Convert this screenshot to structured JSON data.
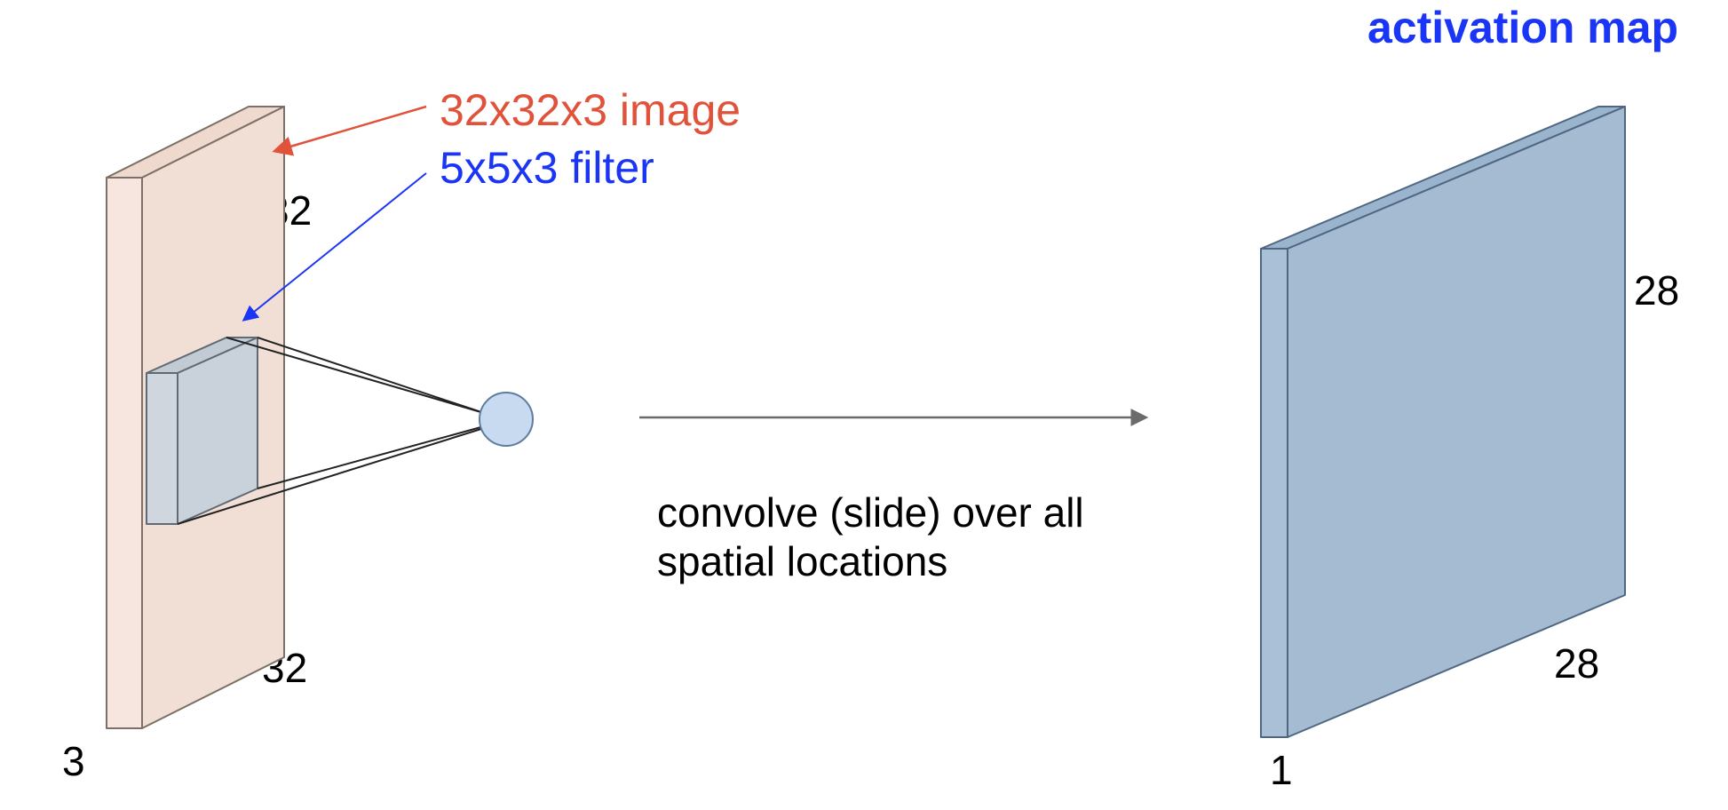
{
  "title": "activation map",
  "input": {
    "label": "32x32x3 image",
    "height": "32",
    "width": "32",
    "depth": "3"
  },
  "filter": {
    "label": "5x5x3 filter"
  },
  "operation": {
    "line1": "convolve (slide) over all",
    "line2": "spatial locations"
  },
  "output": {
    "height": "28",
    "width": "28",
    "depth": "1"
  },
  "colors": {
    "red": "#e1523b",
    "blue": "#1a35f5",
    "imageFill": "#f6e6df",
    "imageStroke": "#7d7066",
    "filterFill": "#cfd6de",
    "filterStroke": "#606a74",
    "neuronFill": "#c7daef",
    "neuronStroke": "#5e7ba0",
    "arrowGrey": "#6b6b6b",
    "outputFill": "#a9c0d7",
    "outputStroke": "#4f6782"
  }
}
